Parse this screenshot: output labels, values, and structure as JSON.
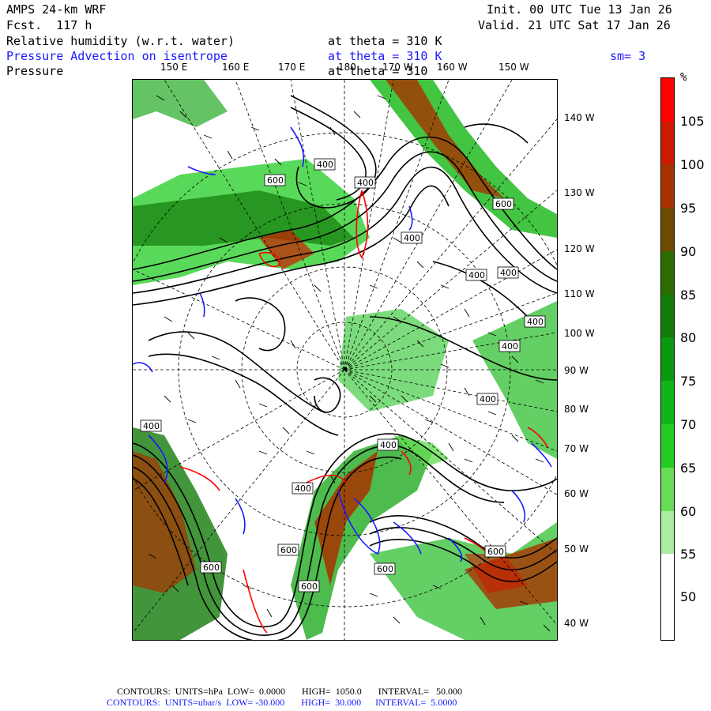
{
  "header": {
    "model": "AMPS 24-km WRF",
    "forecast": "Fcst.  117 h",
    "init": "Init. 00 UTC Tue 13 Jan 26",
    "valid": "Valid. 21 UTC Sat 17 Jan 26",
    "field1_name": "Relative humidity (w.r.t. water)",
    "field1_level": "at theta = 310 K",
    "field2_name": "Pressure Advection on isentrope",
    "field2_level": "at theta = 310 K",
    "field2_smooth": "sm= 3",
    "field3_name": "Pressure",
    "field3_level": "at theta = 310"
  },
  "top_lon_labels": [
    "150 E",
    "160 E",
    "170 E",
    "180",
    "170 W",
    "160 W",
    "150 W"
  ],
  "right_lat_labels": [
    "140 W",
    "130 W",
    "120 W",
    "110 W",
    "100 W",
    "90 W",
    "80 W",
    "70 W",
    "60 W",
    "50 W",
    "40 W"
  ],
  "contour_labels": [
    "600",
    "400",
    "400",
    "600",
    "400",
    "400",
    "400",
    "400",
    "400",
    "400",
    "400",
    "600",
    "400",
    "600",
    "600",
    "600",
    "600",
    "400"
  ],
  "colorbar": {
    "unit": "%",
    "labels": [
      "105",
      "100",
      "95",
      "90",
      "85",
      "80",
      "75",
      "70",
      "65",
      "60",
      "55",
      "50"
    ],
    "colors": [
      "#ff0000",
      "#cc1a00",
      "#a83200",
      "#6e4a00",
      "#2e6b00",
      "#147a0a",
      "#0a9a10",
      "#11b518",
      "#22cc22",
      "#66dd55",
      "#aaeea0",
      "#ffffff"
    ]
  },
  "footer": {
    "line1": "CONTOURS:  UNITS=hPa  LOW=  0.0000       HIGH=  1050.0       INTERVAL=   50.000",
    "line2": "CONTOURS:  UNITS=ubar/s  LOW= -30.000       HIGH=  30.000      INTERVAL=  5.0000"
  },
  "colors": {
    "pressure_contour": "#000000",
    "advection_positive": "#ff0000",
    "advection_negative": "#1a1aff"
  }
}
